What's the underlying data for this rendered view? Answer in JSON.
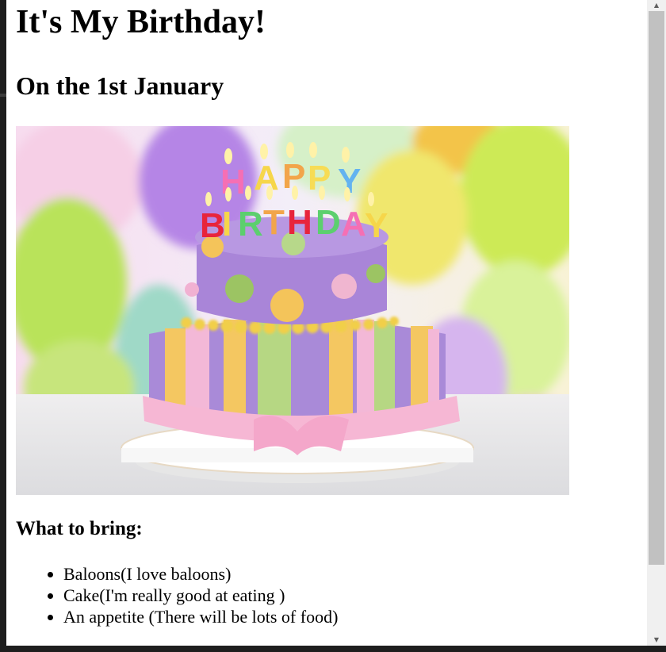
{
  "page": {
    "title": "It's My Birthday!",
    "subtitle": "On the 1st January",
    "bring_heading": "What to bring:",
    "bring_items": [
      "Baloons(I love baloons)",
      "Cake(I'm really good at eating )",
      "An appetite (There will be lots of food)"
    ]
  },
  "photo": {
    "candle_letters_top": [
      "H",
      "A",
      "P",
      "P",
      "Y"
    ],
    "candle_letters_bottom": [
      "B",
      "I",
      "R",
      "T",
      "H",
      "D",
      "A",
      "Y"
    ]
  },
  "icons": {
    "scroll_up": "chevron-up-icon",
    "scroll_down": "chevron-down-icon"
  },
  "colors": {
    "page_bg": "#ffffff",
    "frame": "#1e1e1e",
    "scrollbar_track": "#f0f0f0",
    "scrollbar_thumb": "#c1c1c1"
  }
}
